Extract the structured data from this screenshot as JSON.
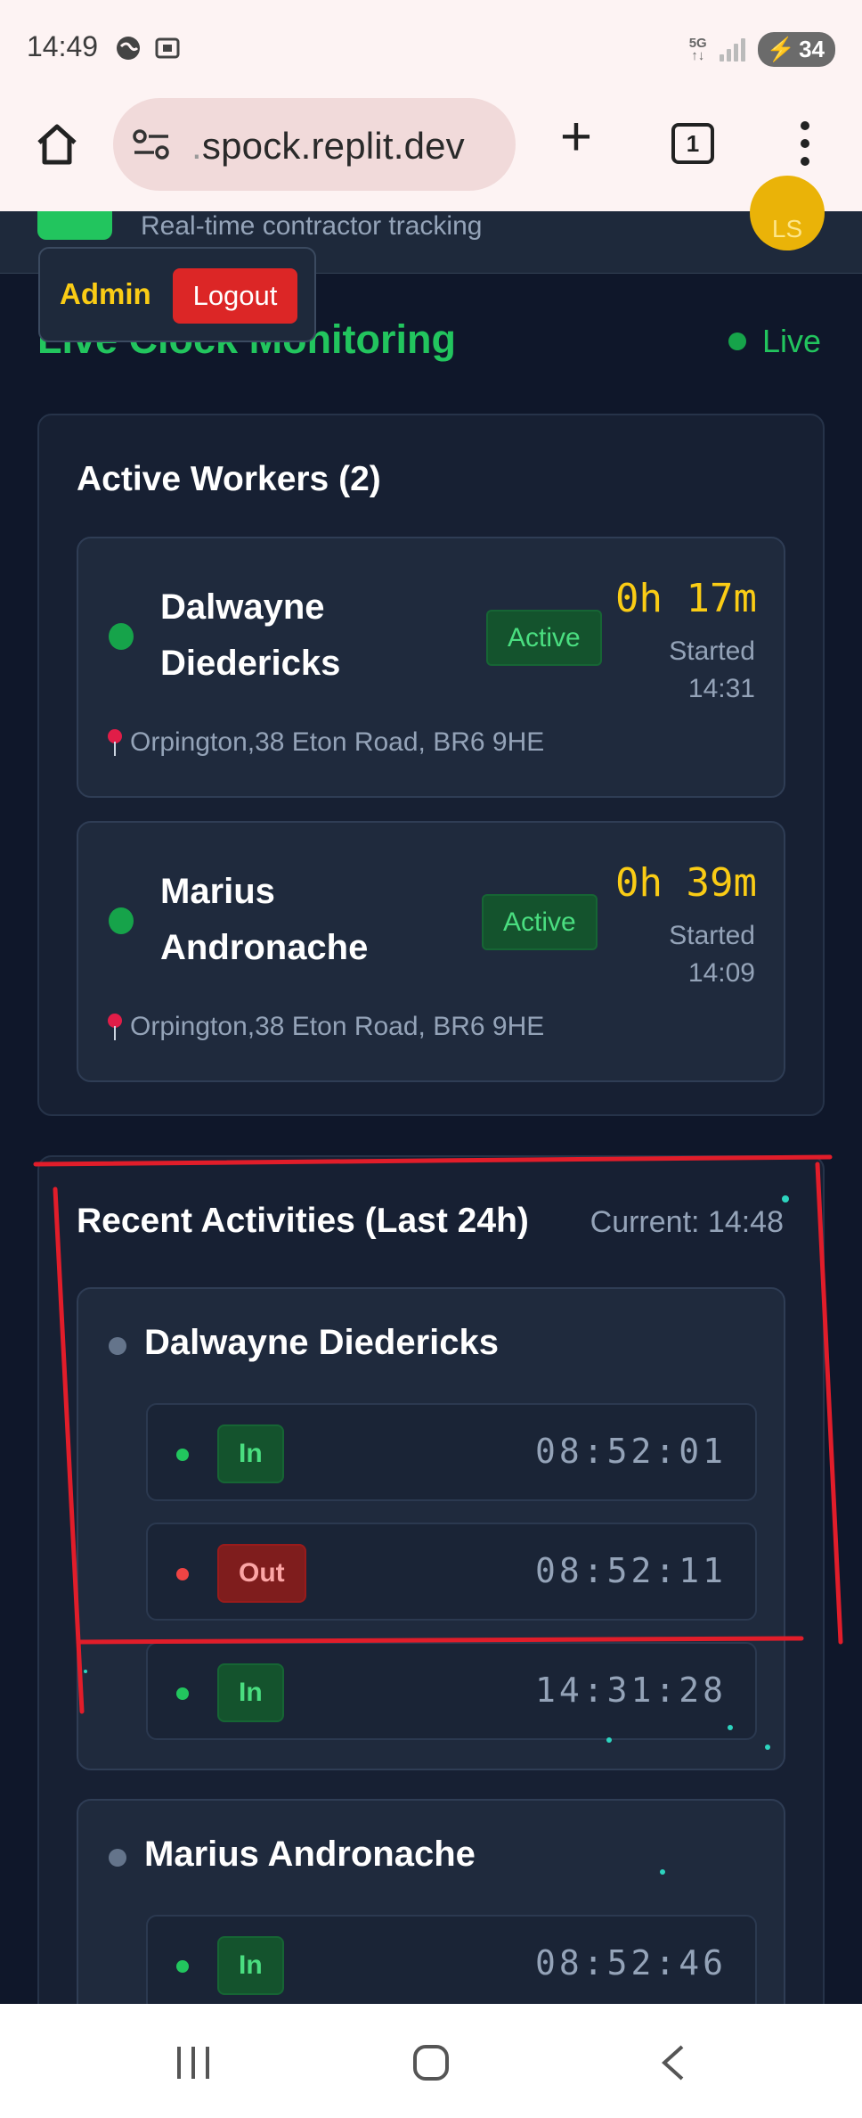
{
  "status_bar": {
    "time": "14:49",
    "network": "5G",
    "battery": "34"
  },
  "browser": {
    "url": "spock.replit.dev",
    "tab_count": "1"
  },
  "header": {
    "subtitle": "Real-time contractor tracking",
    "avatar_initials": "LS"
  },
  "admin_menu": {
    "role": "Admin",
    "logout_label": "Logout"
  },
  "page": {
    "title": "Live Clock Monitoring",
    "live_label": "Live"
  },
  "active_workers": {
    "title": "Active Workers (2)",
    "workers": [
      {
        "name_line1": "Dalwayne",
        "name_line2": "Diedericks",
        "status": "Active",
        "duration": "0h 17m",
        "started_label": "Started",
        "started_time": "14:31",
        "location": "Orpington,38 Eton Road, BR6 9HE"
      },
      {
        "name_line1": "Marius",
        "name_line2": "Andronache",
        "status": "Active",
        "duration": "0h 39m",
        "started_label": "Started",
        "started_time": "14:09",
        "location": "Orpington,38 Eton Road, BR6 9HE"
      }
    ]
  },
  "recent_activities": {
    "title": "Recent Activities (Last 24h)",
    "current": "Current: 14:48",
    "groups": [
      {
        "name": "Dalwayne Diedericks",
        "entries": [
          {
            "type": "In",
            "time": "08:52:01"
          },
          {
            "type": "Out",
            "time": "08:52:11"
          },
          {
            "type": "In",
            "time": "14:31:28"
          }
        ]
      },
      {
        "name": "Marius Andronache",
        "entries": [
          {
            "type": "In",
            "time": "08:52:46"
          }
        ]
      }
    ]
  },
  "colors": {
    "accent_green": "#22c55e",
    "admin_yellow": "#facc15",
    "logout_red": "#dc2626",
    "annotation_red": "#e11d2a"
  },
  "icons": [
    "home-icon",
    "site-settings-icon",
    "new-tab-icon",
    "tab-switcher-icon",
    "more-menu-icon",
    "location-pin-icon"
  ]
}
